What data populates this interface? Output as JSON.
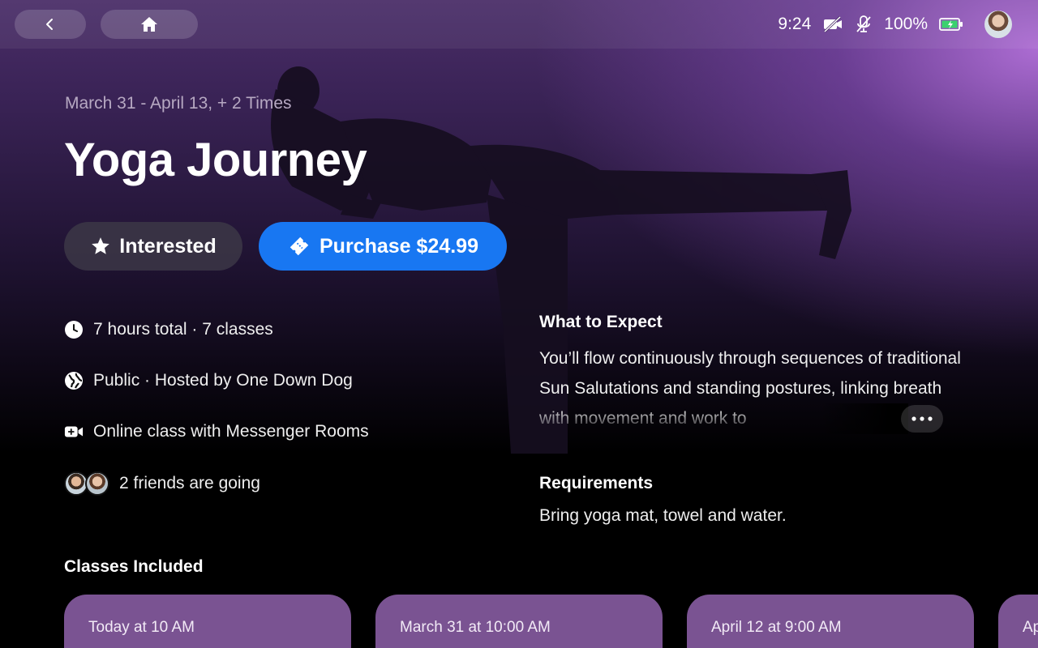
{
  "topbar": {
    "time": "9:24",
    "battery": "100%"
  },
  "event": {
    "date_range": "March 31 - April 13, + 2 Times",
    "title": "Yoga Journey"
  },
  "actions": {
    "interested_label": "Interested",
    "purchase_label": "Purchase $24.99"
  },
  "details": {
    "duration": "7 hours total · 7 classes",
    "host": "Public · Hosted by One Down Dog",
    "online": "Online class with Messenger Rooms",
    "friends": "2 friends are going"
  },
  "expect": {
    "heading": "What to Expect",
    "text": "You’ll flow continuously through sequences of traditional Sun Salutations and standing postures, linking breath with movement and work to"
  },
  "requirements": {
    "heading": "Requirements",
    "text": "Bring yoga mat, towel and water."
  },
  "classes": {
    "heading": "Classes Included",
    "items": [
      {
        "label": "Today at 10 AM"
      },
      {
        "label": "March 31 at 10:00 AM"
      },
      {
        "label": "April 12 at 9:00 AM"
      },
      {
        "label": "Ap"
      }
    ]
  },
  "colors": {
    "accent": "#1877f2",
    "card": "#7a5392"
  }
}
